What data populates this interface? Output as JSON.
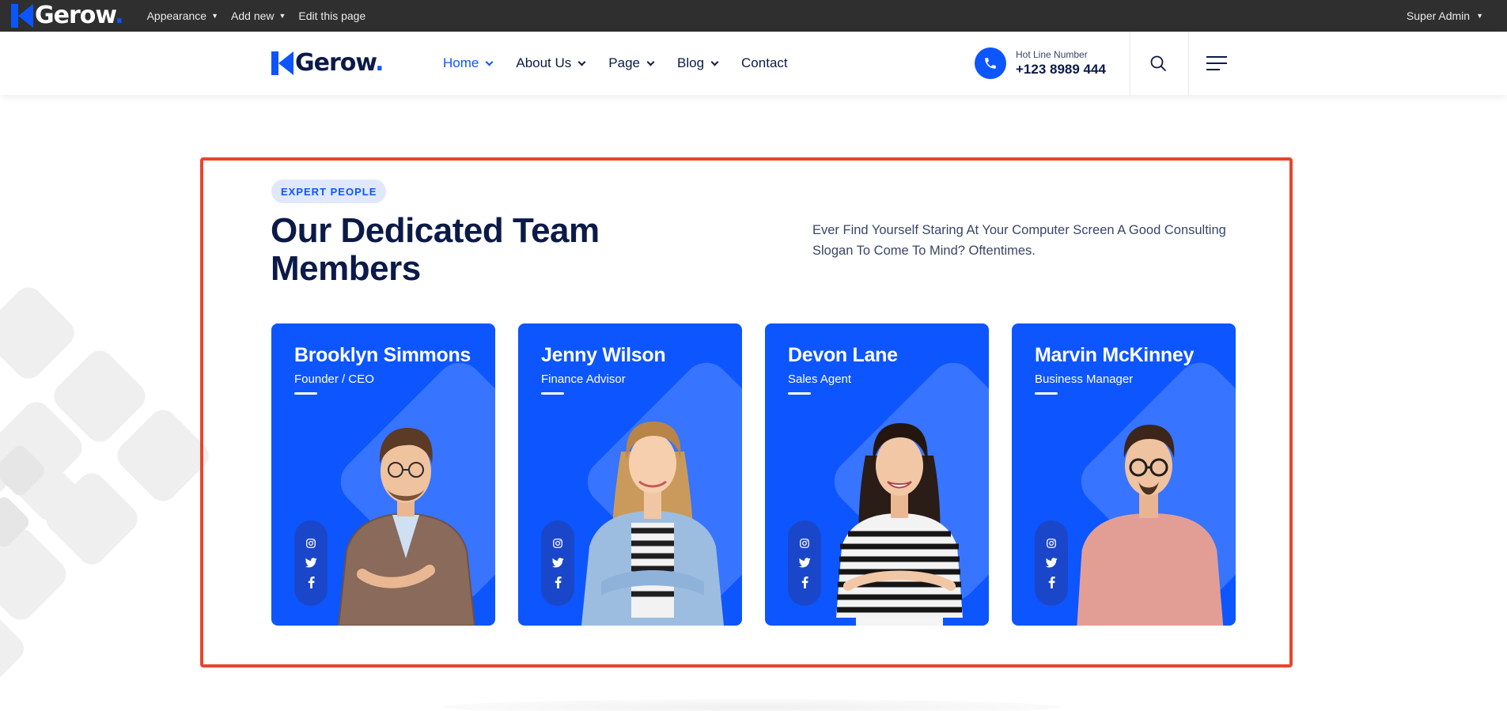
{
  "admin_bar": {
    "logo_text": "Gerow",
    "logo_dot": ".",
    "menu": [
      {
        "label": "Appearance",
        "caret": "▼"
      },
      {
        "label": "Add new",
        "caret": "▼"
      },
      {
        "label": "Edit this page"
      }
    ],
    "user": {
      "label": "Super Admin",
      "caret": "▼"
    }
  },
  "header": {
    "logo_text": "Gerow",
    "logo_dot": ".",
    "nav": [
      {
        "label": "Home",
        "active": true,
        "has_dropdown": true
      },
      {
        "label": "About Us",
        "has_dropdown": true
      },
      {
        "label": "Page",
        "has_dropdown": true
      },
      {
        "label": "Blog",
        "has_dropdown": true
      },
      {
        "label": "Contact",
        "has_dropdown": false
      }
    ],
    "hotline": {
      "label": "Hot Line Number",
      "number": "+123 8989 444",
      "icon": "phone-icon"
    },
    "search_icon": "search-icon",
    "menu_icon": "hamburger-icon"
  },
  "team_section": {
    "badge": "EXPERT PEOPLE",
    "title": "Our Dedicated Team Members",
    "lead": "Ever Find Yourself Staring At Your Computer Screen A Good Consulting Slogan To Come To Mind? Oftentimes.",
    "members": [
      {
        "name": "Brooklyn Simmons",
        "role": "Founder / CEO",
        "social": [
          "instagram-icon",
          "twitter-icon",
          "facebook-icon"
        ]
      },
      {
        "name": "Jenny Wilson",
        "role": "Finance Advisor",
        "social": [
          "instagram-icon",
          "twitter-icon",
          "facebook-icon"
        ]
      },
      {
        "name": "Devon Lane",
        "role": "Sales Agent",
        "social": [
          "instagram-icon",
          "twitter-icon",
          "facebook-icon"
        ]
      },
      {
        "name": "Marvin McKinney",
        "role": "Business Manager",
        "social": [
          "instagram-icon",
          "twitter-icon",
          "facebook-icon"
        ]
      }
    ]
  },
  "colors": {
    "accent": "#0d55ff",
    "navy": "#0b1a48",
    "admin_bar": "#2f2f2f",
    "highlight_frame": "#e8452c",
    "badge_bg": "#dfe8ff"
  }
}
